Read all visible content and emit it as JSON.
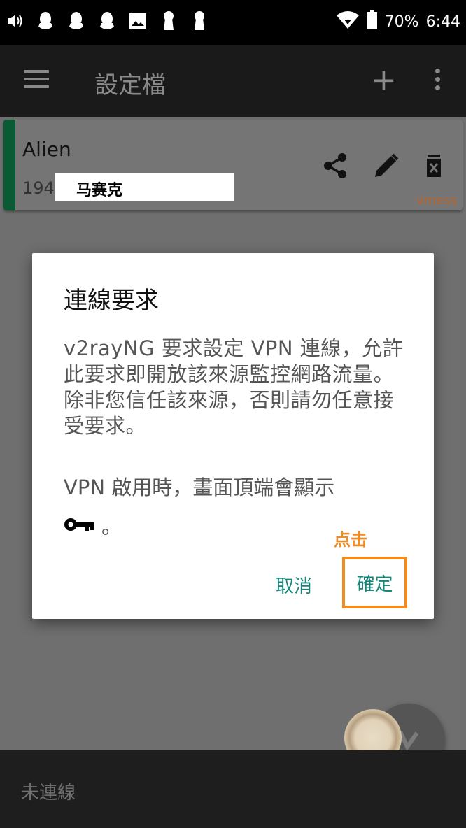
{
  "status_bar": {
    "battery": "70%",
    "time": "6:44",
    "left_icons": [
      "volume-icon",
      "qq-icon",
      "qq-icon",
      "qq-icon",
      "image-icon",
      "keyhole-icon",
      "keyhole-icon"
    ]
  },
  "toolbar": {
    "title": "設定檔",
    "add_label": "+"
  },
  "profile": {
    "name": "Alien",
    "address_prefix": "194",
    "redact_label": "马赛克",
    "type": "vmess"
  },
  "dialog": {
    "title": "連線要求",
    "message": "v2rayNG 要求設定 VPN 連線，允許此要求即開放該來源監控網路流量。除非您信任該來源，否則請勿任意接受要求。",
    "message2": "VPN 啟用時，畫面頂端會顯示",
    "key_suffix": "。",
    "cancel_label": "取消",
    "ok_label": "確定",
    "hint_label": "点击"
  },
  "footer": {
    "connection_status": "未連線"
  },
  "colors": {
    "accent": "#15877a",
    "hint": "#f08b22",
    "card_accent": "#0a5a35"
  }
}
